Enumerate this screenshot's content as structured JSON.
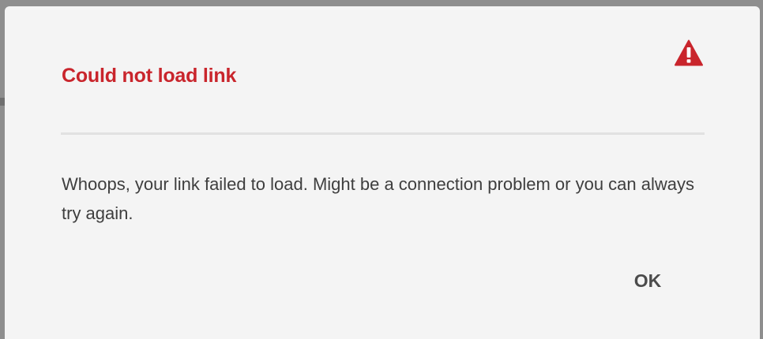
{
  "dialog": {
    "title": "Could not load link",
    "icon": "alert-triangle-icon",
    "title_color": "#c9252c",
    "message": "Whoops, your link failed to load. Might be a connection problem or you can always try again.",
    "ok_label": "OK"
  }
}
